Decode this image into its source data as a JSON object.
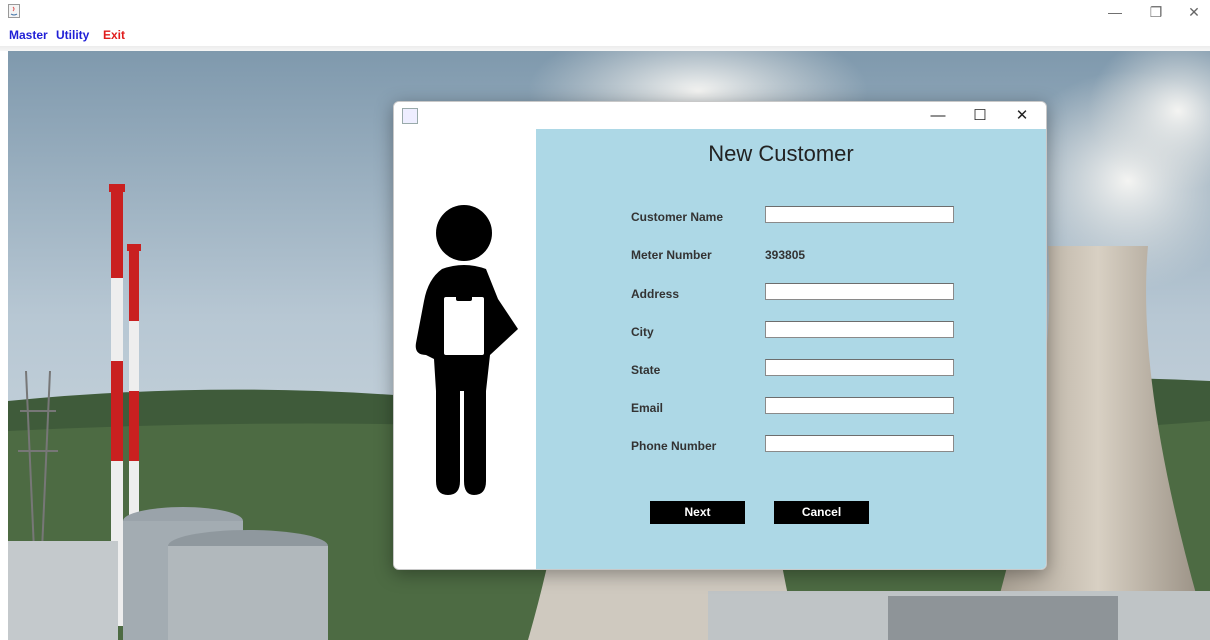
{
  "menu": {
    "master": "Master",
    "utility": "Utility",
    "exit": "Exit"
  },
  "window_controls": {
    "minimize": "—",
    "restore": "❐",
    "close": "✕"
  },
  "dialog": {
    "title": "New Customer",
    "controls": {
      "minimize": "—",
      "maximize": "☐",
      "close": "✕"
    },
    "fields": {
      "customer_name": {
        "label": "Customer Name",
        "value": ""
      },
      "meter_number": {
        "label": "Meter Number",
        "value": "393805"
      },
      "address": {
        "label": "Address",
        "value": ""
      },
      "city": {
        "label": "City",
        "value": ""
      },
      "state": {
        "label": "State",
        "value": ""
      },
      "email": {
        "label": "Email",
        "value": ""
      },
      "phone_number": {
        "label": "Phone Number",
        "value": ""
      }
    },
    "buttons": {
      "next": "Next",
      "cancel": "Cancel"
    }
  },
  "colors": {
    "form_background": "#add8e6",
    "button_background": "#000000",
    "menu_text": "#1f1fd6",
    "exit_text": "#e01b1b"
  },
  "icons": {
    "app": "java-icon",
    "illustration": "person-with-clipboard-icon"
  }
}
